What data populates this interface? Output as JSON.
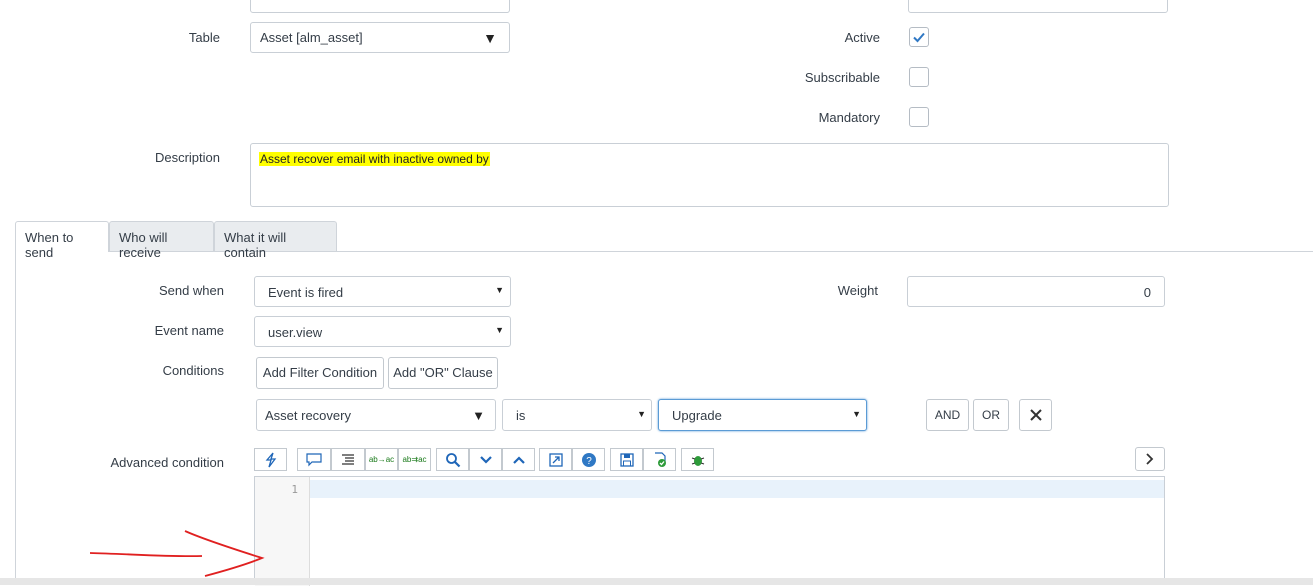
{
  "form": {
    "table_label": "Table",
    "table_value": "Asset [alm_asset]",
    "active_label": "Active",
    "active_checked": true,
    "subscribable_label": "Subscribable",
    "subscribable_checked": false,
    "mandatory_label": "Mandatory",
    "mandatory_checked": false,
    "description_label": "Description",
    "description_value": "Asset recover email with inactive owned by"
  },
  "tabs": [
    {
      "label": "When to send",
      "active": true
    },
    {
      "label": "Who will receive",
      "active": false
    },
    {
      "label": "What it will contain",
      "active": false
    }
  ],
  "when": {
    "send_when_label": "Send when",
    "send_when_value": "Event is fired",
    "weight_label": "Weight",
    "weight_value": "0",
    "event_name_label": "Event name",
    "event_name_value": "user.view",
    "conditions_label": "Conditions",
    "add_filter_label": "Add Filter Condition",
    "add_or_label": "Add \"OR\" Clause",
    "condition_field": "Asset recovery",
    "condition_operator": "is",
    "condition_value": "Upgrade",
    "and_label": "AND",
    "or_label": "OR",
    "advanced_label": "Advanced condition",
    "line_number": "1"
  },
  "toolbar_icons": [
    "format-icon",
    "comment-icon",
    "indent-icon",
    "replace-icon",
    "replace-all-icon",
    "search-icon",
    "chevron-down-icon",
    "chevron-up-icon",
    "fullscreen-icon",
    "help-icon",
    "save-icon",
    "validate-icon",
    "debug-icon"
  ],
  "colors": {
    "highlight": "#ffff00",
    "accent": "#1f66b8",
    "annotation": "#e02020"
  }
}
